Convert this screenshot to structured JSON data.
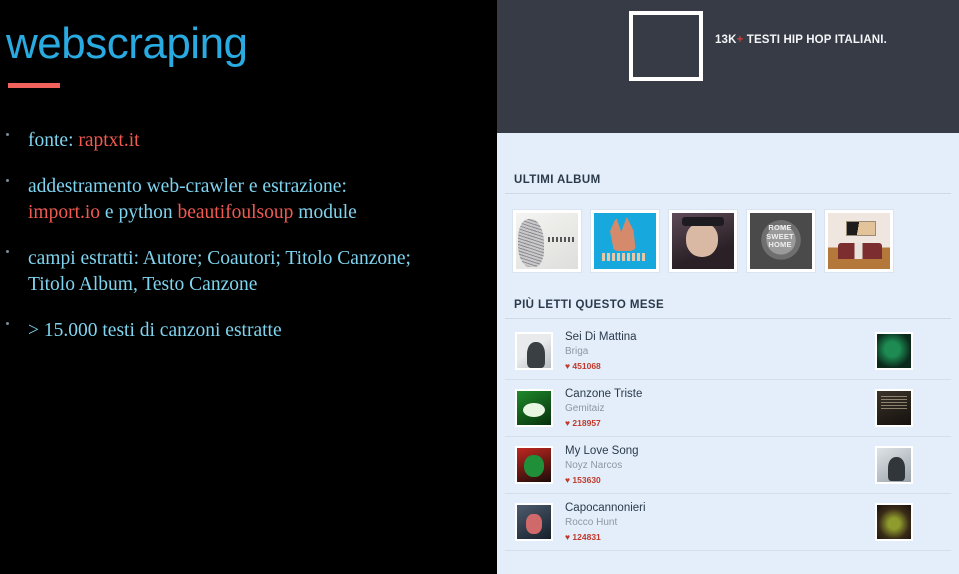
{
  "slide": {
    "title": "webscraping",
    "bullets": [
      {
        "lines": [
          [
            {
              "text": "fonte: ",
              "tone": "blue"
            },
            {
              "text": "raptxt.it",
              "tone": "red"
            }
          ]
        ]
      },
      {
        "lines": [
          [
            {
              "text": "addestramento web-crawler e estrazione:",
              "tone": "blue"
            }
          ],
          [
            {
              "text": "import.io",
              "tone": "red"
            },
            {
              "text": " e python ",
              "tone": "blue"
            },
            {
              "text": "beautifoulsoup",
              "tone": "red"
            },
            {
              "text": " module",
              "tone": "blue"
            }
          ]
        ]
      },
      {
        "lines": [
          [
            {
              "text": "campi estratti: Autore; Coautori; Titolo Canzone;",
              "tone": "blue"
            }
          ],
          [
            {
              "text": "Titolo Album, Testo Canzone",
              "tone": "blue"
            }
          ]
        ]
      },
      {
        "lines": [
          [
            {
              "text": "> 15.000 testi di canzoni estratte",
              "tone": "blue"
            }
          ]
        ]
      }
    ],
    "colors": {
      "title": "#29abe2",
      "rule": "#f2625c",
      "bullet_blue": "#7fd4ef",
      "bullet_red": "#f05a50",
      "background": "#000000"
    }
  },
  "site": {
    "header": {
      "logo_name": "raptxt-logo-square",
      "tagline_count": "13K",
      "tagline_plus": "+",
      "tagline_text": " TESTI HIP HOP ITALIANI.",
      "background": "#363b46",
      "plus_color": "#d03a34"
    },
    "sections": {
      "ultimi_album": {
        "heading": "ULTIMI ALBUM",
        "albums": [
          {
            "name": "album-cover-1",
            "art": "art-1"
          },
          {
            "name": "album-cover-2",
            "art": "art-2"
          },
          {
            "name": "album-cover-3",
            "art": "art-3"
          },
          {
            "name": "album-cover-4",
            "art": "art-4",
            "caption": "ROME SWEET HOME"
          },
          {
            "name": "album-cover-5",
            "art": "art-5"
          }
        ]
      },
      "piu_letti": {
        "heading": "PIÙ LETTI QUESTO MESE",
        "songs": [
          {
            "title": "Sei Di Mattina",
            "artist": "Briga",
            "likes": "451068",
            "heart": "♥",
            "thumb": "th-a",
            "side_thumb": "th-e"
          },
          {
            "title": "Canzone Triste",
            "artist": "Gemitaiz",
            "likes": "218957",
            "heart": "♥",
            "thumb": "th-b",
            "side_thumb": "th-f"
          },
          {
            "title": "My Love Song",
            "artist": "Noyz Narcos",
            "likes": "153630",
            "heart": "♥",
            "thumb": "th-c",
            "side_thumb": "th-g"
          },
          {
            "title": "Capocannonieri",
            "artist": "Rocco Hunt",
            "likes": "124831",
            "heart": "♥",
            "thumb": "th-d",
            "side_thumb": "th-h"
          }
        ]
      }
    },
    "colors": {
      "body_background": "#e3eefa",
      "heading_text": "#2b3a4a",
      "artist_text": "#8b97a3",
      "likes_text": "#c0392b",
      "divider": "#d3dfec"
    }
  }
}
